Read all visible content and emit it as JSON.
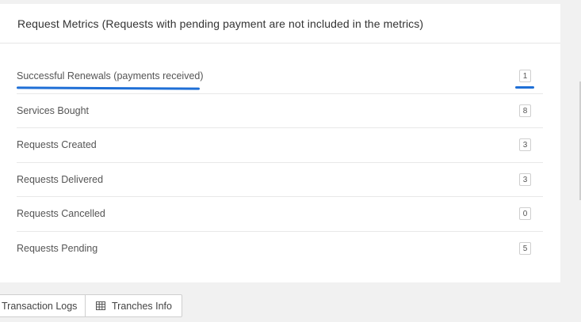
{
  "panel": {
    "title": "Request Metrics (Requests with pending payment are not included in the metrics)"
  },
  "metrics": [
    {
      "label": "Successful Renewals (payments received)",
      "value": "1"
    },
    {
      "label": "Services Bought",
      "value": "8"
    },
    {
      "label": "Requests Created",
      "value": "3"
    },
    {
      "label": "Requests Delivered",
      "value": "3"
    },
    {
      "label": "Requests Cancelled",
      "value": "0"
    },
    {
      "label": "Requests Pending",
      "value": "5"
    }
  ],
  "tabs": [
    {
      "label": "Transaction Logs"
    },
    {
      "label": "Tranches Info",
      "icon": "table-icon"
    }
  ],
  "colors": {
    "annotation": "#1f6fd6",
    "panel_background": "#ffffff",
    "page_background": "#f1f1f1"
  }
}
